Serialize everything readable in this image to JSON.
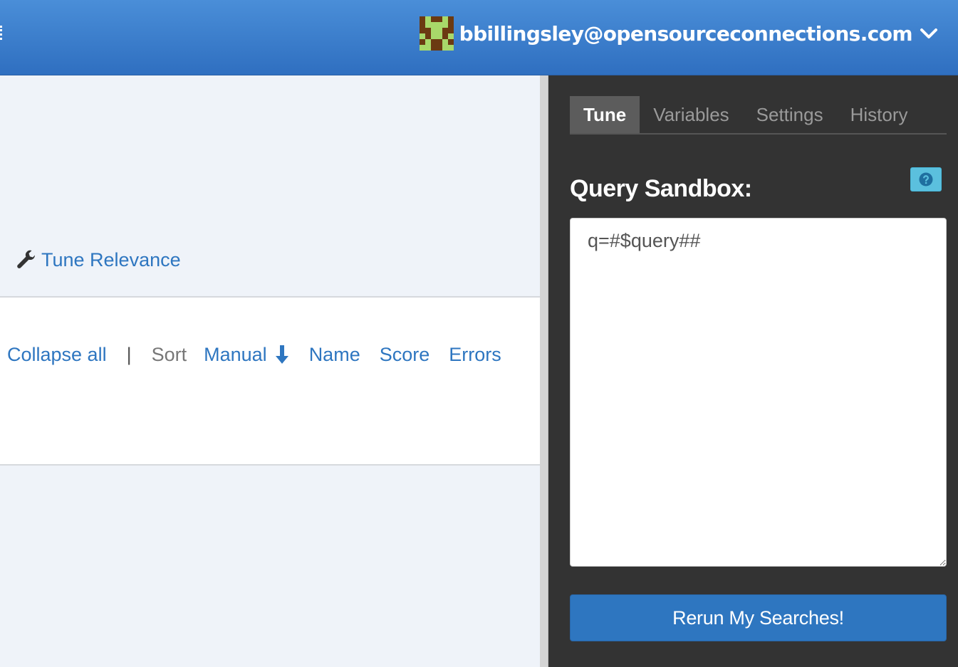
{
  "header": {
    "user_email": "bbillingsley@opensourceconnections.com",
    "avatar_colors": {
      "dark": "#6b3a12",
      "light": "#a8d86a"
    }
  },
  "main": {
    "tune_link_label": "Tune Relevance",
    "collapse_all_label": "Collapse all",
    "separator": "|",
    "sort_label": "Sort",
    "sort_options": [
      "Manual",
      "Name",
      "Score",
      "Errors"
    ]
  },
  "side_panel": {
    "tabs": [
      {
        "label": "Tune",
        "active": true
      },
      {
        "label": "Variables",
        "active": false
      },
      {
        "label": "Settings",
        "active": false
      },
      {
        "label": "History",
        "active": false
      }
    ],
    "sandbox_title": "Query Sandbox:",
    "query_value": "q=#$query##",
    "rerun_label": "Rerun My Searches!"
  },
  "colors": {
    "header_blue": "#3a7fcf",
    "link_blue": "#2e76c0",
    "panel_dark": "#333333",
    "help_cyan": "#5bc0de"
  }
}
